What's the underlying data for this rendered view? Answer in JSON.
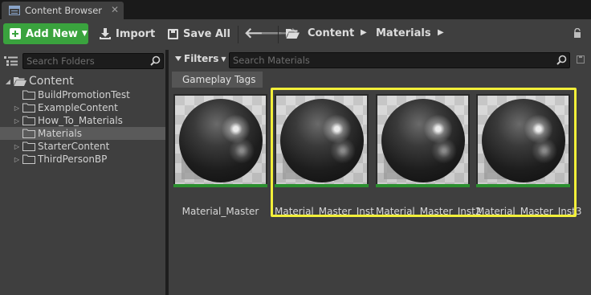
{
  "tab": {
    "label": "Content Browser"
  },
  "toolbar": {
    "add_new_label": "Add New",
    "import_label": "Import",
    "save_all_label": "Save All",
    "breadcrumbs": [
      "Content",
      "Materials"
    ]
  },
  "folders": {
    "search_placeholder": "Search Folders",
    "tree": [
      {
        "label": "Content",
        "expanded": true,
        "root": true
      },
      {
        "label": "BuildPromotionTest"
      },
      {
        "label": "ExampleContent",
        "has_children": true
      },
      {
        "label": "How_To_Materials",
        "has_children": true
      },
      {
        "label": "Materials",
        "selected": true
      },
      {
        "label": "StarterContent",
        "has_children": true
      },
      {
        "label": "ThirdPersonBP",
        "has_children": true
      }
    ]
  },
  "assets_panel": {
    "filters_label": "Filters",
    "search_placeholder": "Search Materials",
    "tag_chip": "Gameplay Tags",
    "assets": [
      {
        "name": "Material_Master",
        "selected": false
      },
      {
        "name": "Material_Master_Inst",
        "selected": true
      },
      {
        "name": "Material_Master_Inst2",
        "selected": true
      },
      {
        "name": "Material_Master_Inst3",
        "selected": true
      }
    ]
  },
  "colors": {
    "accent_green": "#3aa33e",
    "selection_yellow": "#f2ef39",
    "panel_bg": "#3f3f3f"
  }
}
